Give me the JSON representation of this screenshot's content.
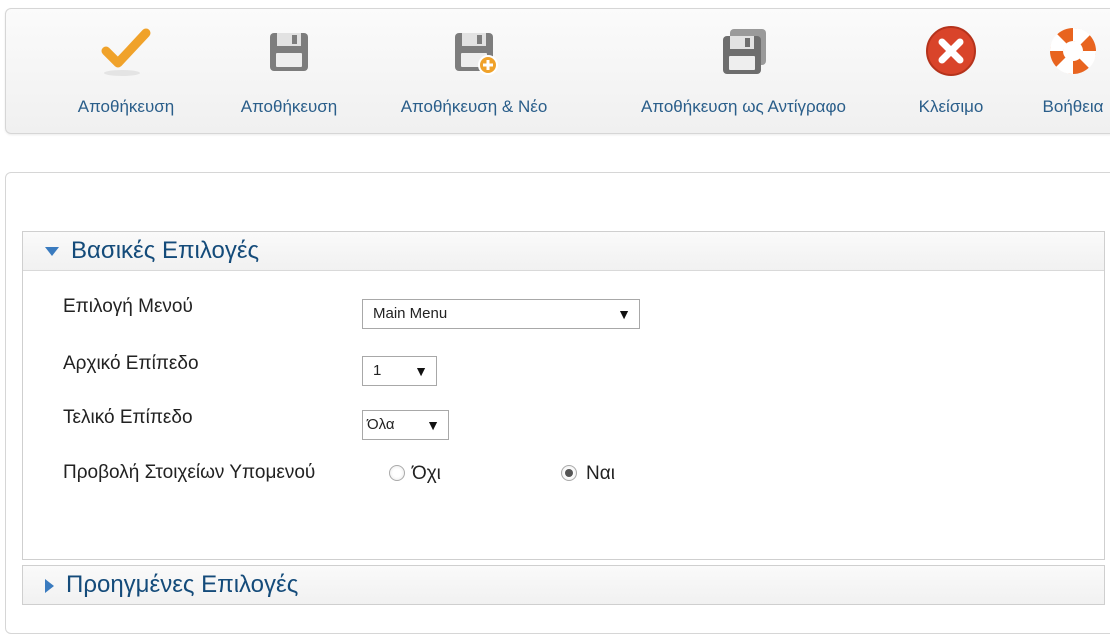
{
  "toolbar": {
    "buttons": [
      {
        "label": "Αποθήκευση",
        "icon": "checkmark-icon"
      },
      {
        "label": "Αποθήκευση",
        "icon": "save-icon"
      },
      {
        "label": "Αποθήκευση & Νέο",
        "icon": "save-new-icon"
      },
      {
        "label": "Αποθήκευση ως Αντίγραφο",
        "icon": "save-copy-icon"
      },
      {
        "label": "Κλείσιμο",
        "icon": "close-icon"
      },
      {
        "label": "Βοήθεια",
        "icon": "help-lifebuoy-icon"
      }
    ],
    "colors": {
      "check": "#f0a22a",
      "save": "#7d7d7d",
      "close": "#d9442a",
      "help": "#e8641f",
      "label": "#2a5e8a"
    }
  },
  "basic_options": {
    "title": "Βασικές Επιλογές",
    "menu_label": "Επιλογή Μενού",
    "menu_value": "Main Menu",
    "start_level_label": "Αρχικό Επίπεδο",
    "start_level_value": "1",
    "end_level_label": "Τελικό Επίπεδο",
    "end_level_value": "Όλα",
    "submenu_label": "Προβολή Στοιχείων Υπομενού",
    "submenu_no": "Όχι",
    "submenu_yes": "Ναι",
    "submenu_selected": "Ναι"
  },
  "advanced_options": {
    "title": "Προηγμένες Επιλογές"
  }
}
